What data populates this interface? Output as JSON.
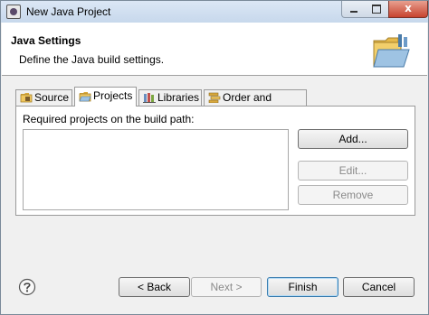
{
  "window": {
    "title": "New Java Project",
    "close_glyph": "x"
  },
  "header": {
    "title": "Java Settings",
    "description": "Define the Java build settings."
  },
  "tabs": [
    {
      "label": "Source",
      "icon": "source-folder-icon",
      "active": false
    },
    {
      "label": "Projects",
      "icon": "projects-folder-icon",
      "active": true
    },
    {
      "label": "Libraries",
      "icon": "libraries-icon",
      "active": false
    },
    {
      "label": "Order and Export",
      "icon": "order-export-icon",
      "active": false
    }
  ],
  "projects_panel": {
    "label": "Required projects on the build path:",
    "projects": [],
    "buttons": {
      "add": "Add...",
      "edit": "Edit...",
      "remove": "Remove"
    }
  },
  "footer": {
    "back": "< Back",
    "next": "Next >",
    "finish": "Finish",
    "cancel": "Cancel"
  },
  "colors": {
    "default_button_border": "#3c7fb1",
    "header_background": "#ffffff",
    "dialog_background": "#f0f0f0",
    "close_button": "#c7432f"
  }
}
